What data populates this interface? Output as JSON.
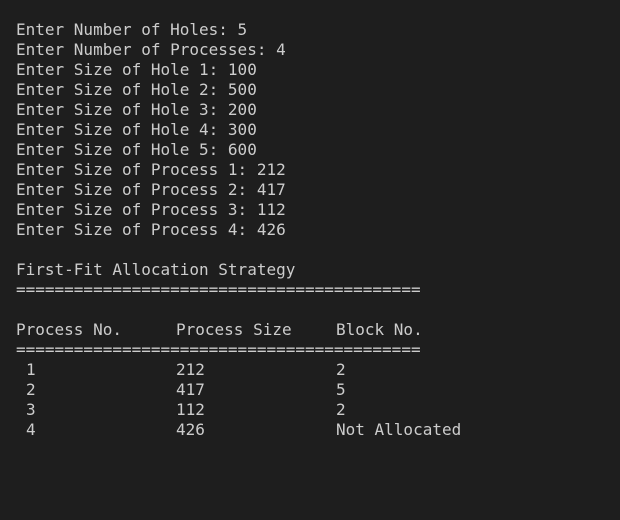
{
  "prompts": [
    "Enter Number of Holes: 5",
    "Enter Number of Processes: 4",
    "Enter Size of Hole 1: 100",
    "Enter Size of Hole 2: 500",
    "Enter Size of Hole 3: 200",
    "Enter Size of Hole 4: 300",
    "Enter Size of Hole 5: 600",
    "Enter Size of Process 1: 212",
    "Enter Size of Process 2: 417",
    "Enter Size of Process 3: 112",
    "Enter Size of Process 4: 426"
  ],
  "strategy_title": "First-Fit Allocation Strategy",
  "separator": "==========================================",
  "table": {
    "headers": {
      "process_no": "Process No.",
      "process_size": "Process Size",
      "block_no": "Block No."
    },
    "rows": [
      {
        "process_no": "1",
        "process_size": "212",
        "block_no": "2"
      },
      {
        "process_no": "2",
        "process_size": "417",
        "block_no": "5"
      },
      {
        "process_no": "3",
        "process_size": "112",
        "block_no": "2"
      },
      {
        "process_no": "4",
        "process_size": "426",
        "block_no": "Not Allocated"
      }
    ]
  }
}
